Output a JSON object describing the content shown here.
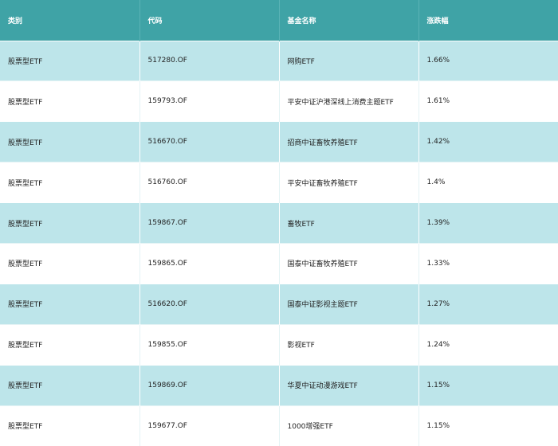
{
  "table": {
    "headers": [
      "类别",
      "代码",
      "基金名称",
      "涨跌幅"
    ],
    "rows": [
      [
        "股票型ETF",
        "517280.OF",
        "网购ETF",
        "1.66%"
      ],
      [
        "股票型ETF",
        "159793.OF",
        "平安中证沪港深线上消费主题ETF",
        "1.61%"
      ],
      [
        "股票型ETF",
        "516670.OF",
        "招商中证畜牧养殖ETF",
        "1.42%"
      ],
      [
        "股票型ETF",
        "516760.OF",
        "平安中证畜牧养殖ETF",
        "1.4%"
      ],
      [
        "股票型ETF",
        "159867.OF",
        "畜牧ETF",
        "1.39%"
      ],
      [
        "股票型ETF",
        "159865.OF",
        "国泰中证畜牧养殖ETF",
        "1.33%"
      ],
      [
        "股票型ETF",
        "516620.OF",
        "国泰中证影视主题ETF",
        "1.27%"
      ],
      [
        "股票型ETF",
        "159855.OF",
        "影视ETF",
        "1.24%"
      ],
      [
        "股票型ETF",
        "159869.OF",
        "华夏中证动漫游戏ETF",
        "1.15%"
      ],
      [
        "股票型ETF",
        "159677.OF",
        "1000增强ETF",
        "1.15%"
      ]
    ]
  },
  "colors": {
    "header_bg": "#3fa3a6",
    "header_text": "#ffffff",
    "row_alt_bg": "#bde5ea",
    "row_bg": "#ffffff"
  }
}
